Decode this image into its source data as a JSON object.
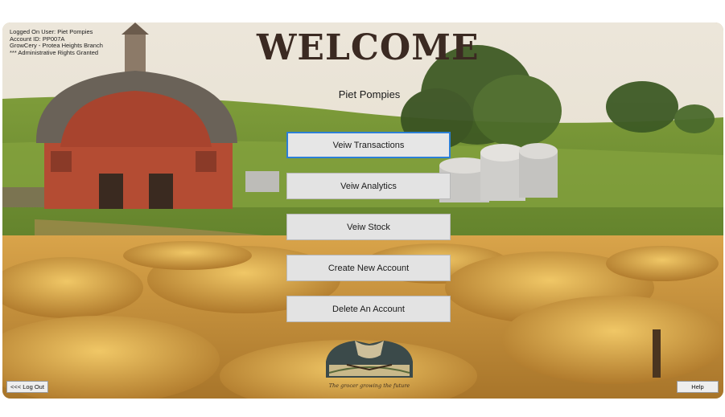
{
  "user_info": {
    "line1": "Logged On User: Piet Pompies",
    "line2": "Account ID: PP007A",
    "line3": "GrowCery - Protea Heights Branch",
    "line4": "*** Administrative Rights Granted"
  },
  "welcome": {
    "title": "WELCOME",
    "user_name": "Piet Pompies"
  },
  "menu": [
    {
      "label": "Veiw Transactions"
    },
    {
      "label": "Veiw Analytics"
    },
    {
      "label": "Veiw Stock"
    },
    {
      "label": "Create New Account"
    },
    {
      "label": "Delete An Account"
    }
  ],
  "footer": {
    "logout_label": "<<< Log Out",
    "help_label": "Help",
    "logo_caption": "The grocer growing the future"
  },
  "colors": {
    "focus_border": "#2b7fd6",
    "button_bg": "#e3e3e3"
  }
}
